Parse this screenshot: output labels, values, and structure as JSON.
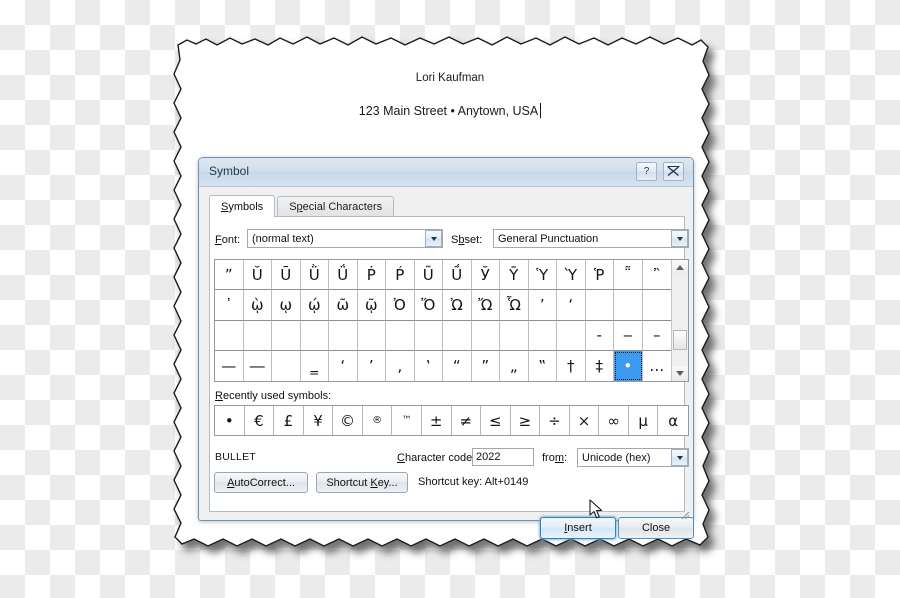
{
  "document": {
    "name_line": "Lori Kaufman",
    "address_line": "123 Main Street • Anytown, USA"
  },
  "dialog": {
    "title": "Symbol",
    "help_button": "?",
    "close_button_icon": "close-x-icon",
    "tabs": [
      {
        "label": "Symbols",
        "mnemonic": "S",
        "active": true
      },
      {
        "label": "Special Characters",
        "mnemonic": "p",
        "active": false
      }
    ],
    "font": {
      "label": "Font:",
      "mnemonic": "F",
      "value": "(normal text)"
    },
    "subset": {
      "label": "Subset:",
      "mnemonic": "b",
      "value": "General Punctuation"
    },
    "char_grid": {
      "columns": 16,
      "rows": 4,
      "selected": {
        "row": 3,
        "col": 14,
        "char": "•"
      },
      "cells": [
        [
          "ˮ",
          "Ŭ",
          "Ū",
          "Ǜ",
          "Ǘ",
          "Ṗ",
          "Ṕ",
          "Ũ",
          "Ṹ",
          "Ў",
          "Ȳ",
          "Ὑ",
          "Ὺ",
          "Ῥ",
          "῁",
          "῍"
        ],
        [
          "῾",
          "ῲ",
          "ῳ",
          "ῴ",
          "ῶ",
          "ῷ",
          "Ὀ",
          "Ὄ",
          "Ὠ",
          "Ὤ",
          "Ὧ",
          "ʼ",
          "ʻ",
          "",
          "",
          ""
        ],
        [
          "",
          "",
          "",
          "",
          "",
          "",
          "",
          "",
          "",
          "",
          "",
          "",
          "",
          "‐",
          "‒",
          "–"
        ],
        [
          "—",
          "―",
          "",
          "‗",
          "‘",
          "’",
          "‚",
          "‛",
          "“",
          "”",
          "„",
          "‟",
          "†",
          "‡",
          "•",
          "…"
        ]
      ]
    },
    "recently_used": {
      "label": "Recently used symbols:",
      "mnemonic": "R",
      "symbols": [
        "•",
        "€",
        "£",
        "¥",
        "©",
        "®",
        "™",
        "±",
        "≠",
        "≤",
        "≥",
        "÷",
        "×",
        "∞",
        "μ",
        "α"
      ]
    },
    "character_name": "BULLET",
    "character_code": {
      "label": "Character code:",
      "mnemonic": "C",
      "value": "2022"
    },
    "from": {
      "label": "from:",
      "mnemonic": "m",
      "value": "Unicode (hex)"
    },
    "autocorrect_button": {
      "label": "AutoCorrect...",
      "mnemonic": "A"
    },
    "shortcut_key_button": {
      "label": "Shortcut Key...",
      "mnemonic": "K"
    },
    "shortcut_text": "Shortcut key: Alt+0149",
    "insert_button": {
      "label": "Insert",
      "mnemonic": "I"
    },
    "close_dialog_button": {
      "label": "Close"
    }
  },
  "colors": {
    "selection_blue": "#3c9bf0",
    "titlebar_blue": "#d2dfec",
    "focus_border": "#3c7fb1",
    "dialog_bg": "#f0f0f0"
  }
}
